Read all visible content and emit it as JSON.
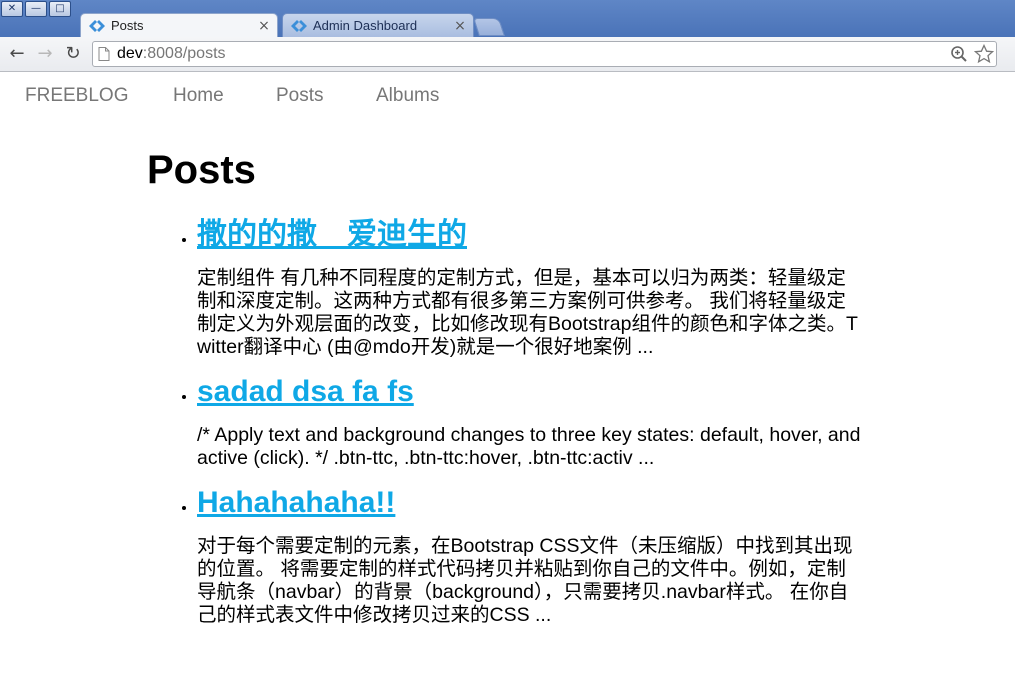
{
  "browser": {
    "tabs": [
      {
        "title": "Posts",
        "active": true
      },
      {
        "title": "Admin Dashboard",
        "active": false
      }
    ],
    "url_host": "dev",
    "url_rest": ":8008/posts"
  },
  "navbar": {
    "brand": "FREEBLOG",
    "items": [
      "Home",
      "Posts",
      "Albums"
    ]
  },
  "page_title": "Posts",
  "posts": [
    {
      "title": "撒的的撒　爱迪生的",
      "excerpt": "定制组件 有几种不同程度的定制方式，但是，基本可以归为两类：轻量级定制和深度定制。这两种方式都有很多第三方案例可供参考。 我们将轻量级定制定义为外观层面的改变，比如修改现有Bootstrap组件的颜色和字体之类。Twitter翻译中心 (由@mdo开发)就是一个很好地案例 ..."
    },
    {
      "title": "sadad dsa fa fs",
      "excerpt": "/* Apply text and background changes to three key states: default, hover, and active (click). */ .btn-ttc, .btn-ttc:hover, .btn-ttc:activ ..."
    },
    {
      "title": "Hahahahaha!!",
      "excerpt": "对于每个需要定制的元素，在Bootstrap CSS文件（未压缩版）中找到其出现的位置。 将需要定制的样式代码拷贝并粘贴到你自己的文件中。例如，定制导航条（navbar）的背景（background），只需要拷贝.navbar样式。 在你自己的样式表文件中修改拷贝过来的CSS ..."
    }
  ],
  "colors": {
    "link": "#0fa8e6",
    "nav_text": "#777777"
  }
}
